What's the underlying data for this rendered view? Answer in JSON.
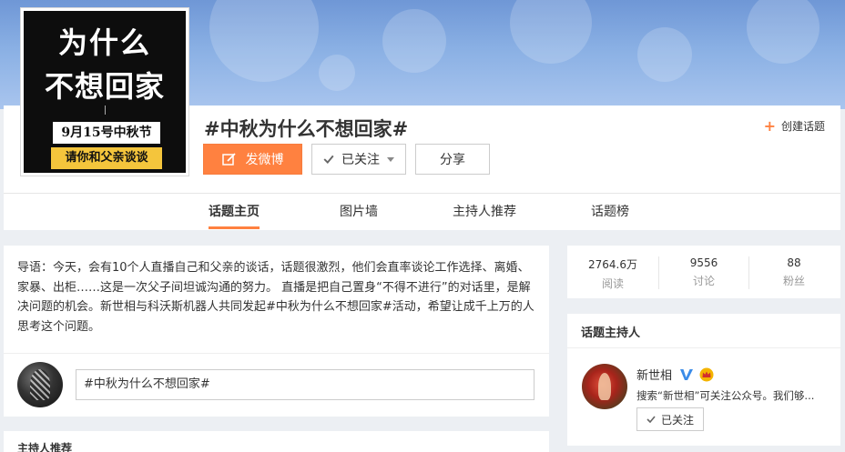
{
  "cover": {
    "line1": "为什么",
    "line2": "不想回家",
    "date": "9月15号中秋节",
    "subtitle": "请你和父亲谈谈"
  },
  "header": {
    "title": "#中秋为什么不想回家#",
    "create_topic": "创建话题",
    "post_button": "发微博",
    "follow_button": "已关注",
    "share_button": "分享"
  },
  "tabs": [
    {
      "label": "话题主页",
      "active": true
    },
    {
      "label": "图片墙",
      "active": false
    },
    {
      "label": "主持人推荐",
      "active": false
    },
    {
      "label": "话题榜",
      "active": false
    }
  ],
  "intro": {
    "text": "导语：今天，会有10个人直播自己和父亲的谈话，话题很激烈，他们会直率谈论工作选择、离婚、家暴、出柜……这是一次父子间坦诚沟通的努力。 直播是把自己置身“不得不进行”的对话里，是解决问题的机会。新世相与科沃斯机器人共同发起#中秋为什么不想回家#活动，希望让成千上万的人思考这个问题。",
    "input_value": "#中秋为什么不想回家#"
  },
  "host_recommend": {
    "title": "主持人推荐"
  },
  "stats": [
    {
      "value": "2764.6万",
      "label": "阅读"
    },
    {
      "value": "9556",
      "label": "讨论"
    },
    {
      "value": "88",
      "label": "粉丝"
    }
  ],
  "host": {
    "section_title": "话题主持人",
    "name": "新世相",
    "description": "搜索“新世相”可关注公众号。我们够...",
    "follow_label": "已关注"
  },
  "colors": {
    "accent": "#ff8140",
    "verified": "#3b8ce8",
    "crown": "#f4b400"
  }
}
